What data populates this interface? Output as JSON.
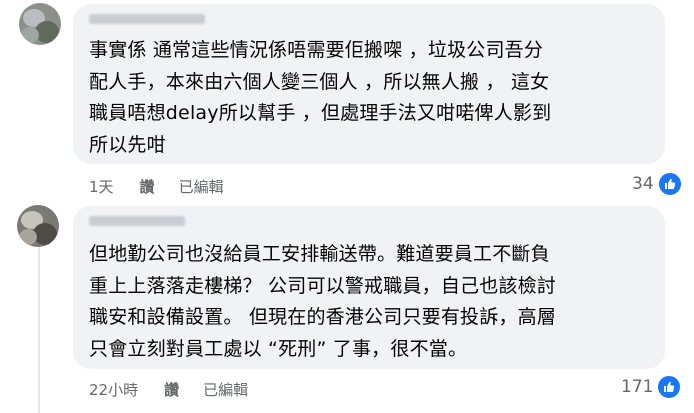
{
  "comments": [
    {
      "text_lines": [
        "事實係 通常這些情況係唔需要佢搬㗎 ，垃圾公司吾分",
        "配人手，本來由六個人變三個人 ，所以無人搬 ， 這女",
        "職員唔想delay所以幫手 ，但處理手法又咁喏俾人影到",
        "所以先咁"
      ],
      "time": "1天",
      "like_label": "讚",
      "edited_label": "已編輯",
      "reaction_count": "34",
      "reaction_icon": "like-icon"
    },
    {
      "text_lines": [
        "但地勤公司也沒給員工安排輸送帶。難道要員工不斷負",
        "重上上落落走樓梯？ 公司可以警戒職員，自己也該檢討",
        "職安和設備設置。 但現在的香港公司只要有投訴，高層",
        "只會立刻對員工處以 “死刑” 了事，很不當。"
      ],
      "time": "22小時",
      "like_label": "讚",
      "edited_label": "已編輯",
      "reaction_count": "171",
      "reaction_icon": "like-icon"
    }
  ],
  "colors": {
    "bubble": "#f0f2f5",
    "text": "#050505",
    "meta": "#65676b",
    "like_blue": "#1877f2"
  }
}
